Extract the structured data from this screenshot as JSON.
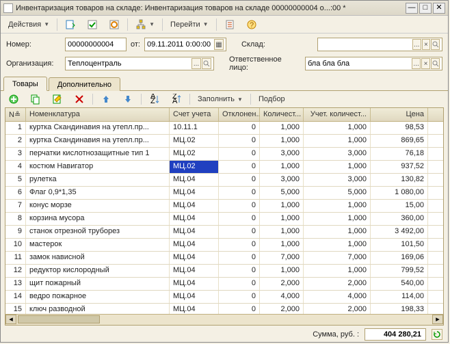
{
  "window": {
    "title": "Инвентаризация товаров на складе: Инвентаризация товаров на складе 00000000004 о...:00 *"
  },
  "toolbar": {
    "actions": "Действия",
    "goto": "Перейти"
  },
  "header": {
    "number_label": "Номер:",
    "number": "00000000004",
    "from_label": "от:",
    "date": "09.11.2011 0:00:00",
    "warehouse_label": "Склад:",
    "warehouse": "",
    "org_label": "Организация:",
    "org": "Теплоцентраль",
    "resp_label": "Ответственное лицо:",
    "resp": "бла бла бла"
  },
  "tabs": {
    "goods": "Товары",
    "extra": "Дополнительно"
  },
  "tablebar": {
    "fill": "Заполнить",
    "pick": "Подбор"
  },
  "columns": {
    "num": "N≗",
    "nom": "Номенклатура",
    "account": "Счет учета",
    "dev": "Отклонен...",
    "qty": "Количест...",
    "acc_qty": "Учет. количест...",
    "price": "Цена"
  },
  "rows": [
    {
      "n": 1,
      "nom": "куртка Скандинавия на утепл.пр...",
      "acc": "10.11.1",
      "dev": "0",
      "qty": "1,000",
      "aqty": "1,000",
      "price": "98,53"
    },
    {
      "n": 2,
      "nom": "куртка Скандинавия на утепл.пр...",
      "acc": "МЦ.02",
      "dev": "0",
      "qty": "1,000",
      "aqty": "1,000",
      "price": "869,65"
    },
    {
      "n": 3,
      "nom": "перчатки кислотнозащитные тип 1",
      "acc": "МЦ.02",
      "dev": "0",
      "qty": "3,000",
      "aqty": "3,000",
      "price": "76,18"
    },
    {
      "n": 4,
      "nom": "костюм Навигатор",
      "acc": "МЦ.02",
      "dev": "0",
      "qty": "1,000",
      "aqty": "1,000",
      "price": "937,52",
      "selected": true
    },
    {
      "n": 5,
      "nom": "рулетка",
      "acc": "МЦ.04",
      "dev": "0",
      "qty": "3,000",
      "aqty": "3,000",
      "price": "130,82"
    },
    {
      "n": 6,
      "nom": "Флаг 0,9*1,35",
      "acc": "МЦ.04",
      "dev": "0",
      "qty": "5,000",
      "aqty": "5,000",
      "price": "1 080,00"
    },
    {
      "n": 7,
      "nom": "конус морзе",
      "acc": "МЦ.04",
      "dev": "0",
      "qty": "1,000",
      "aqty": "1,000",
      "price": "15,00"
    },
    {
      "n": 8,
      "nom": "корзина мусора",
      "acc": "МЦ.04",
      "dev": "0",
      "qty": "1,000",
      "aqty": "1,000",
      "price": "360,00"
    },
    {
      "n": 9,
      "nom": "станок отрезной труборез",
      "acc": "МЦ.04",
      "dev": "0",
      "qty": "1,000",
      "aqty": "1,000",
      "price": "3 492,00"
    },
    {
      "n": 10,
      "nom": "мастерок",
      "acc": "МЦ.04",
      "dev": "0",
      "qty": "1,000",
      "aqty": "1,000",
      "price": "101,50"
    },
    {
      "n": 11,
      "nom": "замок нависной",
      "acc": "МЦ.04",
      "dev": "0",
      "qty": "7,000",
      "aqty": "7,000",
      "price": "169,06"
    },
    {
      "n": 12,
      "nom": "редуктор кислородный",
      "acc": "МЦ.04",
      "dev": "0",
      "qty": "1,000",
      "aqty": "1,000",
      "price": "799,52"
    },
    {
      "n": 13,
      "nom": "щит пожарный",
      "acc": "МЦ.04",
      "dev": "0",
      "qty": "2,000",
      "aqty": "2,000",
      "price": "540,00"
    },
    {
      "n": 14,
      "nom": "ведро пожарное",
      "acc": "МЦ.04",
      "dev": "0",
      "qty": "4,000",
      "aqty": "4,000",
      "price": "114,00"
    },
    {
      "n": 15,
      "nom": "ключ разводной",
      "acc": "МЦ.04",
      "dev": "0",
      "qty": "2,000",
      "aqty": "2,000",
      "price": "198,33"
    }
  ],
  "footer": {
    "sum_label": "Сумма, руб. :",
    "sum_value": "404 280,21"
  }
}
